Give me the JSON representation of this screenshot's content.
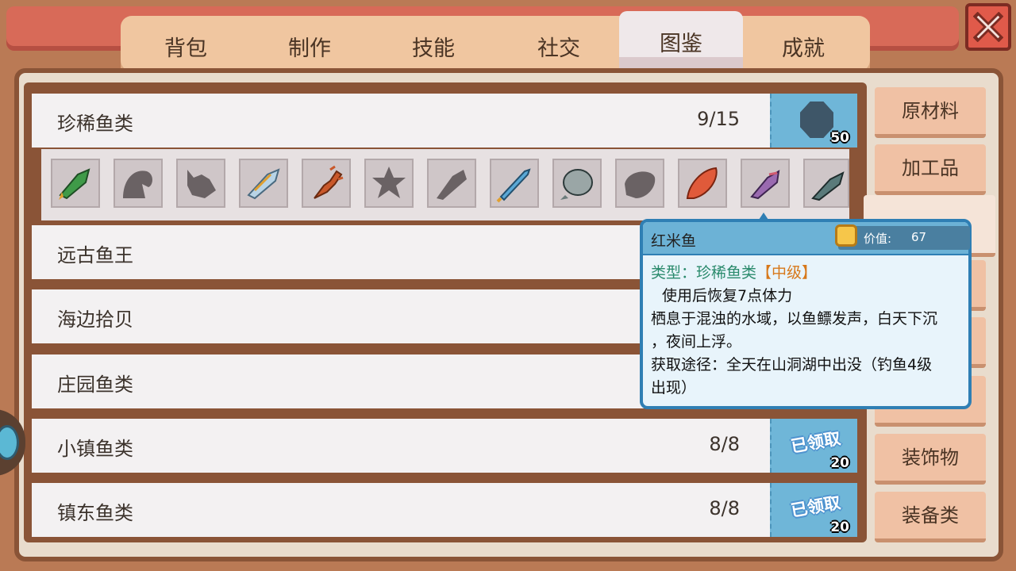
{
  "tabs": [
    {
      "label": "背包"
    },
    {
      "label": "制作"
    },
    {
      "label": "技能"
    },
    {
      "label": "社交"
    },
    {
      "label": "图鉴",
      "active": true
    },
    {
      "label": "成就"
    }
  ],
  "categories": [
    {
      "label": "原材料"
    },
    {
      "label": "加工品"
    },
    {
      "label": "",
      "active": true
    },
    {
      "label": ""
    },
    {
      "label": ""
    },
    {
      "label": ""
    },
    {
      "label": "装饰物"
    },
    {
      "label": "装备类"
    }
  ],
  "collections": [
    {
      "name": "珍稀鱼类",
      "count": "9/15",
      "reward": "50",
      "claimed": false
    },
    {
      "name": "远古鱼王"
    },
    {
      "name": "海边拾贝"
    },
    {
      "name": "庄园鱼类"
    },
    {
      "name": "小镇鱼类",
      "count": "8/8",
      "reward": "20",
      "claimed": true,
      "claimed_label": "已领取"
    },
    {
      "name": "镇东鱼类",
      "count": "8/8",
      "reward": "20",
      "claimed": true,
      "claimed_label": "已领取"
    }
  ],
  "fish_slots": [
    {
      "icon": "green-fish-icon",
      "color": "#3f9a48",
      "discovered": true
    },
    {
      "icon": "unknown-fish-silhouette-icon",
      "discovered": false
    },
    {
      "icon": "unknown-fish-silhouette-icon",
      "discovered": false
    },
    {
      "icon": "blue-striped-fish-icon",
      "color": "#8cb8d6",
      "discovered": true
    },
    {
      "icon": "lobster-icon",
      "color": "#c9582a",
      "discovered": true
    },
    {
      "icon": "unknown-starfish-silhouette-icon",
      "discovered": false
    },
    {
      "icon": "unknown-fish-silhouette-icon",
      "discovered": false
    },
    {
      "icon": "blue-needle-fish-icon",
      "color": "#5aa8d6",
      "discovered": true
    },
    {
      "icon": "grey-round-fish-icon",
      "color": "#9aa6a6",
      "discovered": true
    },
    {
      "icon": "unknown-fish-silhouette-icon",
      "discovered": false
    },
    {
      "icon": "red-mullet-fish-icon",
      "color": "#e05a3a",
      "discovered": true
    },
    {
      "icon": "purple-fish-icon",
      "color": "#9a6ab0",
      "discovered": true
    },
    {
      "icon": "dark-silver-fish-icon",
      "color": "#5a7a7a",
      "discovered": true
    }
  ],
  "tooltip": {
    "name": "红米鱼",
    "price_label": "价值:",
    "price": "67",
    "type_label": "类型：珍稀鱼类",
    "grade": "【中级】",
    "effect": "使用后恢复7点体力",
    "desc_line1": "栖息于混浊的水域，以鱼鳔发声，白天下沉",
    "desc_line2": "，夜间上浮。",
    "source_line1": "获取途径：全天在山洞湖中出没（钓鱼4级",
    "source_line2": "出现）"
  }
}
